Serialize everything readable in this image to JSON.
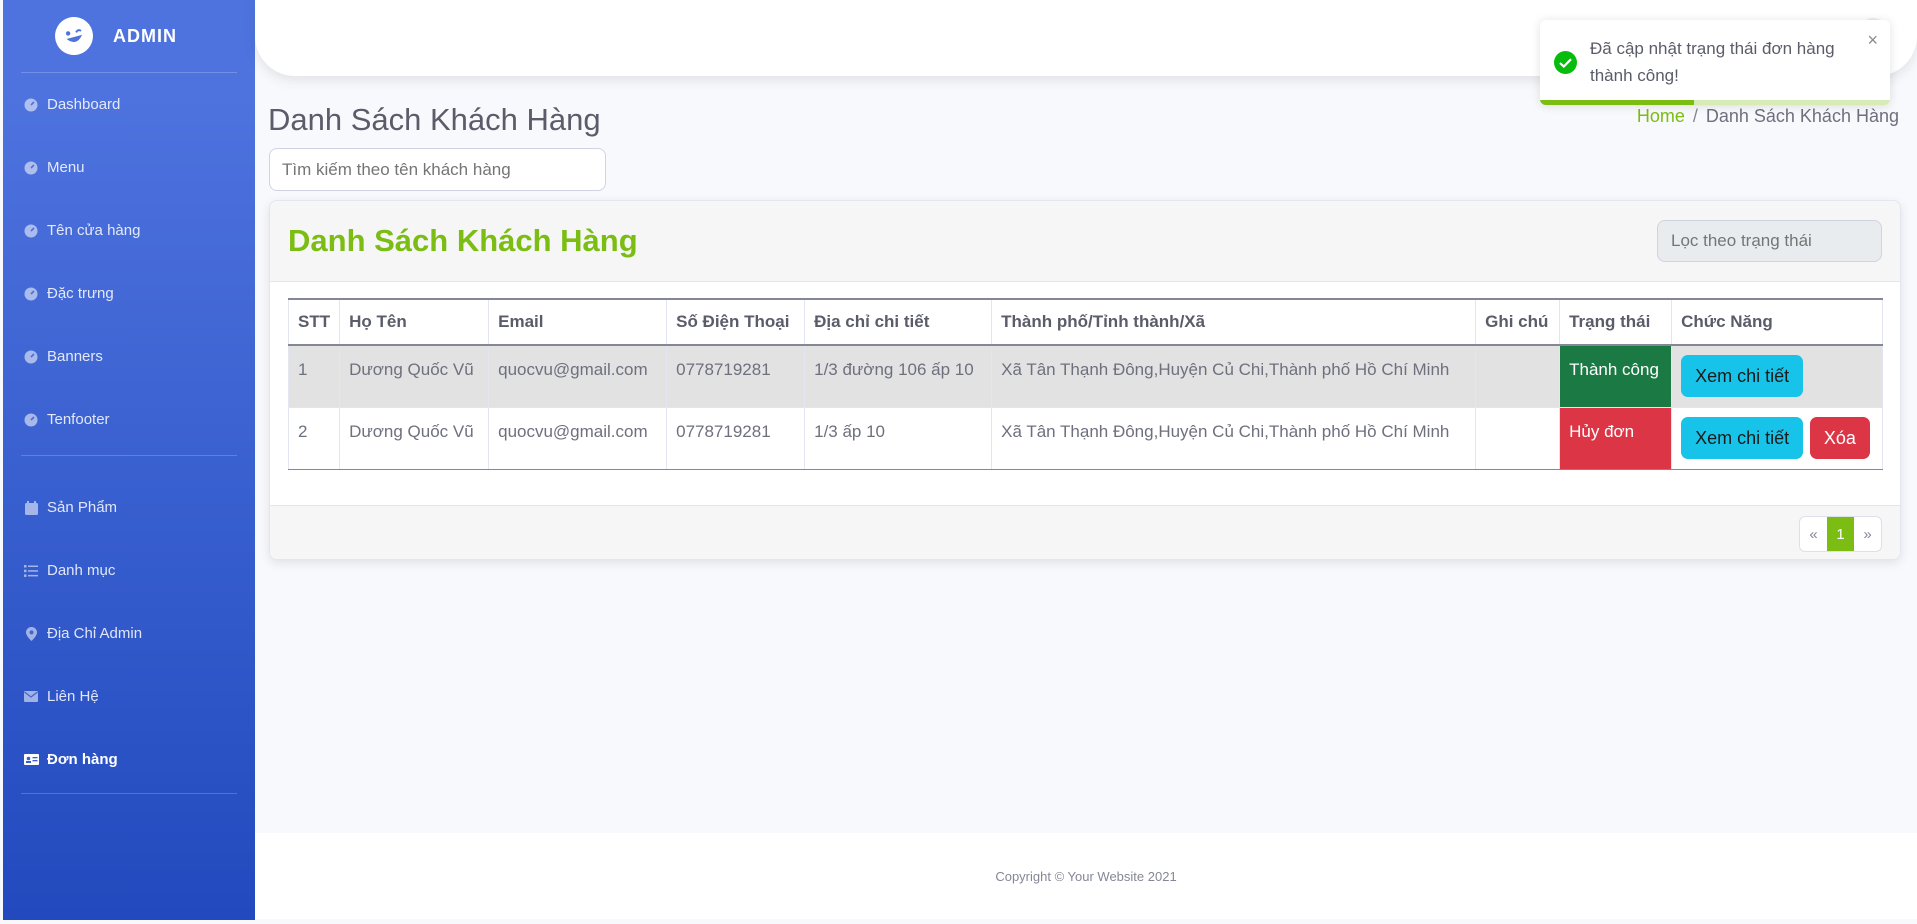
{
  "sidebar": {
    "brand": "ADMIN",
    "items": [
      {
        "label": "Dashboard",
        "icon": "dashboard-icon"
      },
      {
        "label": "Menu",
        "icon": "dashboard-icon"
      },
      {
        "label": "Tên cửa hàng",
        "icon": "dashboard-icon"
      },
      {
        "label": "Đặc trưng",
        "icon": "dashboard-icon"
      },
      {
        "label": "Banners",
        "icon": "dashboard-icon"
      },
      {
        "label": "Tenfooter",
        "icon": "dashboard-icon"
      },
      {
        "label": "Sản Phẩm",
        "icon": "calendar-icon"
      },
      {
        "label": "Danh mục",
        "icon": "list-icon"
      },
      {
        "label": "Địa Chỉ Admin",
        "icon": "map-marker-icon"
      },
      {
        "label": "Liên Hệ",
        "icon": "envelope-icon"
      },
      {
        "label": "Đơn hàng",
        "icon": "id-card-icon",
        "active": true
      }
    ]
  },
  "page": {
    "title": "Danh Sách Khách Hàng",
    "breadcrumb": {
      "home": "Home",
      "sep": "/",
      "current": "Danh Sách Khách Hàng"
    },
    "search_placeholder": "Tìm kiếm theo tên khách hàng"
  },
  "card": {
    "title": "Danh Sách Khách Hàng",
    "filter_placeholder": "Lọc theo trạng thái"
  },
  "table": {
    "headers": [
      "STT",
      "Họ Tên",
      "Email",
      "Số Điện Thoại",
      "Địa chỉ chi tiết",
      "Thành phố/Tỉnh thành/Xã",
      "Ghi chú",
      "Trạng thái",
      "Chức Năng"
    ],
    "rows": [
      {
        "stt": "1",
        "name": "Dương Quốc Vũ",
        "email": "quocvu@gmail.com",
        "phone": "0778719281",
        "address": "1/3 đường 106 ấp 10",
        "city": "Xã Tân Thạnh Đông,Huyện Củ Chi,Thành phố Hồ Chí Minh",
        "note": "",
        "status": "Thành công",
        "view_label": "Xem chi tiết"
      },
      {
        "stt": "2",
        "name": "Dương Quốc Vũ",
        "email": "quocvu@gmail.com",
        "phone": "0778719281",
        "address": "1/3 ấp 10",
        "city": "Xã Tân Thạnh Đông,Huyện Củ Chi,Thành phố Hồ Chí Minh",
        "note": "",
        "status": "Hủy đơn",
        "view_label": "Xem chi tiết",
        "delete_label": "Xóa"
      }
    ]
  },
  "pagination": {
    "prev": "«",
    "current": "1",
    "next": "»"
  },
  "footer": {
    "copyright": "Copyright © Your Website 2021"
  },
  "toast": {
    "message": "Đã cập nhật trạng thái đơn hàng thành công!",
    "close": "×",
    "progress": 0.44
  },
  "colors": {
    "sidebar_start": "#4e73df",
    "sidebar_end": "#224abe",
    "accent": "#7bbd12",
    "success": "#1b7a44",
    "danger": "#dc3545",
    "info": "#17c3e8"
  }
}
